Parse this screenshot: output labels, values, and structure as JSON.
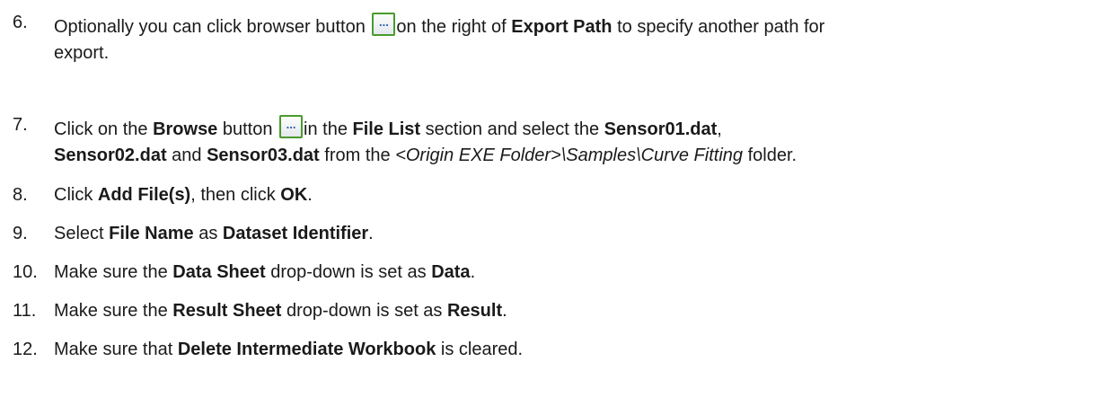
{
  "steps": [
    {
      "number": "6.",
      "lines": [
        {
          "pre": "Optionally you can click browser button ",
          "post": "on the right of ",
          "b1": "Export Path",
          "tail": " to specify another path for"
        },
        {
          "text": "export."
        }
      ]
    },
    {
      "number": "7.",
      "lines": [
        {
          "pre": "Click on the ",
          "b1": "Browse",
          "mid": " button ",
          "post": "in the ",
          "b2": "File List",
          "mid2": " section and select the ",
          "b3": "Sensor01.dat",
          "tail": ","
        },
        {
          "b1": "Sensor02.dat",
          "mid": " and ",
          "b2": "Sensor03.dat",
          "mid2": " from the ",
          "i1": "<Origin EXE Folder>\\Samples\\Curve Fitting",
          "tail": " folder."
        }
      ]
    },
    {
      "number": "8.",
      "pre": "Click ",
      "b1": "Add File(s)",
      "mid": ", then click ",
      "b2": "OK",
      "tail": "."
    },
    {
      "number": "9.",
      "pre": "Select ",
      "b1": "File Name",
      "mid": " as ",
      "b2": "Dataset Identifier",
      "tail": "."
    },
    {
      "number": "10.",
      "pre": "Make sure the ",
      "b1": "Data Sheet",
      "mid": " drop-down is set as ",
      "b2": "Data",
      "tail": "."
    },
    {
      "number": "11.",
      "pre": "Make sure the ",
      "b1": "Result Sheet",
      "mid": " drop-down is set as ",
      "b2": "Result",
      "tail": "."
    },
    {
      "number": "12.",
      "pre": "Make sure that ",
      "b1": "Delete Intermediate Workbook",
      "tail": " is cleared."
    }
  ],
  "browse_button_glyph": "...",
  "icons": [
    "browse-button-icon"
  ]
}
